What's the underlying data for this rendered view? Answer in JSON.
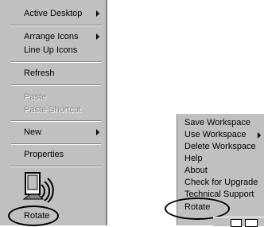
{
  "left_menu": {
    "items": [
      {
        "label": "Active Desktop",
        "has_submenu": true,
        "enabled": true
      },
      {
        "label": "Arrange Icons",
        "has_submenu": true,
        "enabled": true
      },
      {
        "label": "Line Up Icons",
        "has_submenu": false,
        "enabled": true
      },
      {
        "label": "Refresh",
        "has_submenu": false,
        "enabled": true
      },
      {
        "label": "Paste",
        "has_submenu": false,
        "enabled": false
      },
      {
        "label": "Paste Shortcut",
        "has_submenu": false,
        "enabled": false
      },
      {
        "label": "New",
        "has_submenu": true,
        "enabled": true
      },
      {
        "label": "Properties",
        "has_submenu": false,
        "enabled": true
      },
      {
        "label": "Rotate",
        "has_submenu": false,
        "enabled": true,
        "highlighted": true
      }
    ],
    "icon": "rotate-device-icon"
  },
  "right_menu": {
    "items": [
      {
        "label": "Save Workspace",
        "has_submenu": false
      },
      {
        "label": "Use Workspace",
        "has_submenu": true
      },
      {
        "label": "Delete Workspace",
        "has_submenu": false
      },
      {
        "label": "Help",
        "has_submenu": false
      },
      {
        "label": "About",
        "has_submenu": false
      },
      {
        "label": "Check for Upgrade",
        "has_submenu": false
      },
      {
        "label": "Technical Support",
        "has_submenu": false
      },
      {
        "label": "Rotate",
        "has_submenu": false,
        "highlighted": true
      }
    ]
  },
  "colors": {
    "menu_bg": "#c0c0c0",
    "disabled_text": "#808080",
    "highlight_oval": "#000000"
  }
}
